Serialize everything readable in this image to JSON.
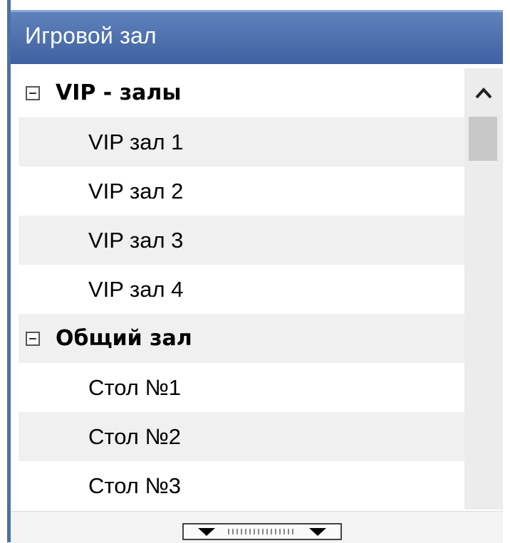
{
  "window": {
    "title": "Игровой зал"
  },
  "tree": {
    "groups": [
      {
        "label": "VIP - залы",
        "expanded": true,
        "items": [
          "VIP зал 1",
          "VIP зал 2",
          "VIP зал 3",
          "VIP зал 4"
        ]
      },
      {
        "label": "Общий зал",
        "expanded": true,
        "items": [
          "Стол №1",
          "Стол №2",
          "Стол №3"
        ]
      }
    ]
  },
  "icons": {
    "scroll_up": "chevron-up-icon",
    "toggle": "collapse-minus-icon",
    "splitter": "splitter-arrows-icon"
  },
  "colors": {
    "titlebar": "#4a6dae",
    "title_text": "#ffffff",
    "alt_row": "#f0f0f0",
    "scrollbar": "#ececec",
    "thumb": "#c8c8c8"
  }
}
